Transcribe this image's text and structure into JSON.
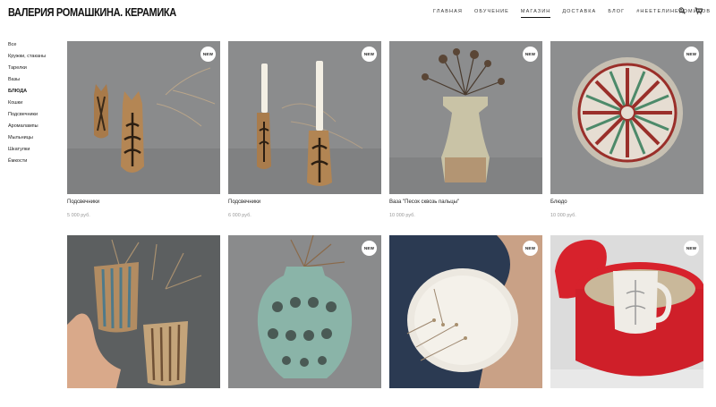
{
  "header": {
    "brand": "ВАЛЕРИЯ РОМАШКИНА. КЕРАМИКА",
    "nav": [
      {
        "label": "ГЛАВНАЯ",
        "active": false
      },
      {
        "label": "ОБУЧЕНИЕ",
        "active": false
      },
      {
        "label": "МАГАЗИН",
        "active": true
      },
      {
        "label": "ДОСТАВКА",
        "active": false
      },
      {
        "label": "БЛОГ",
        "active": false
      },
      {
        "label": "#НЕЕТЕЛИНЕДОМИКОВ",
        "active": false
      }
    ],
    "icons": [
      "search-icon",
      "cart-icon"
    ]
  },
  "sidebar": {
    "items": [
      {
        "label": "Все",
        "active": false
      },
      {
        "label": "Кружки, стаканы",
        "active": false
      },
      {
        "label": "Тарелки",
        "active": false
      },
      {
        "label": "Вазы",
        "active": false
      },
      {
        "label": "БЛЮДА",
        "active": true
      },
      {
        "label": "Кошки",
        "active": false
      },
      {
        "label": "Подсвечники",
        "active": false
      },
      {
        "label": "Аромалампы",
        "active": false
      },
      {
        "label": "Мыльницы",
        "active": false
      },
      {
        "label": "Шкатулки",
        "active": false
      },
      {
        "label": "Ёмкости",
        "active": false
      }
    ]
  },
  "products": [
    {
      "title": "Подсвечники",
      "price": "5 000 руб.",
      "badge": "NEW"
    },
    {
      "title": "Подсвечники",
      "price": "6 000 руб.",
      "badge": "NEW"
    },
    {
      "title": "Ваза \"Песок сквозь пальцы\"",
      "price": "10 000 руб.",
      "badge": "NEW"
    },
    {
      "title": "Блюдо",
      "price": "10 000 руб.",
      "badge": "NEW"
    },
    {
      "title": "",
      "price": "",
      "badge": ""
    },
    {
      "title": "",
      "price": "",
      "badge": "NEW"
    },
    {
      "title": "",
      "price": "",
      "badge": "NEW"
    },
    {
      "title": "",
      "price": "",
      "badge": "NEW"
    }
  ],
  "colors": {
    "photo_grey": "#8a8b8c",
    "badge_bg": "#ffffff",
    "price_grey": "#999999"
  }
}
